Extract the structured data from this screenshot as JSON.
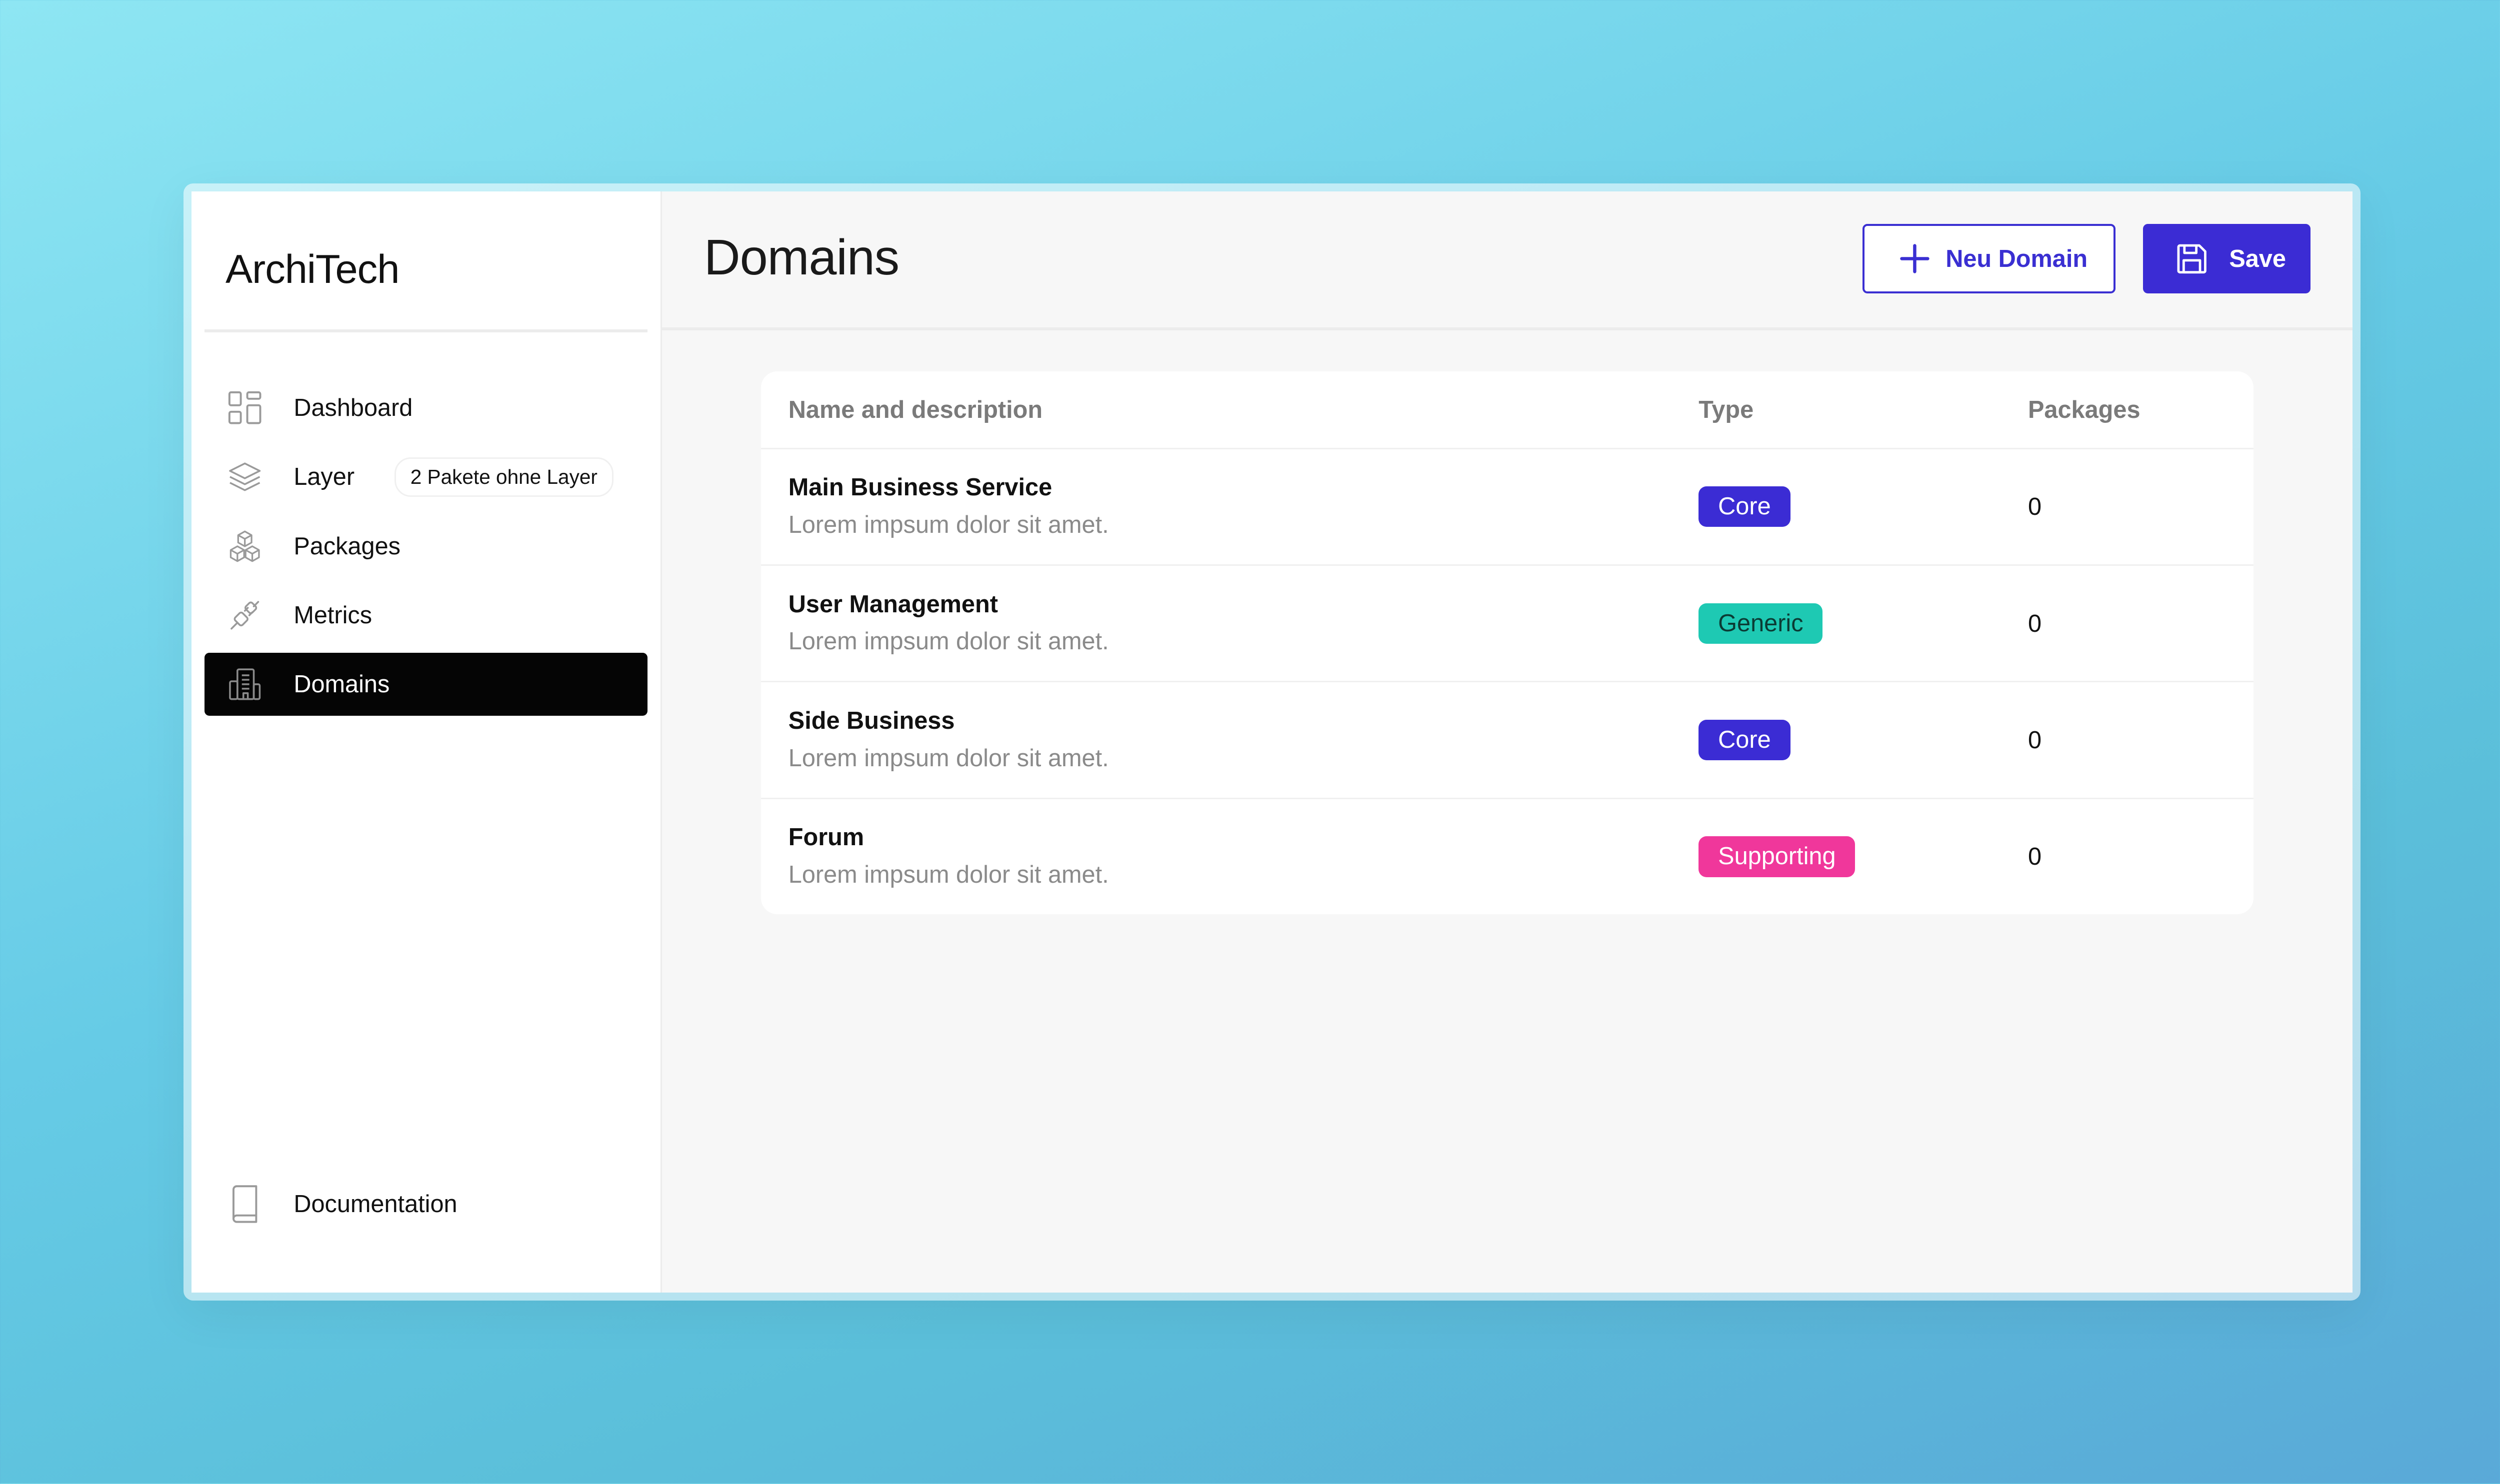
{
  "app": {
    "brand": "ArchiTech"
  },
  "sidebar": {
    "items": [
      {
        "label": "Dashboard",
        "icon": "dashboard-grid-icon"
      },
      {
        "label": "Layer",
        "icon": "layers-icon",
        "pill": "2 Pakete ohne Layer"
      },
      {
        "label": "Packages",
        "icon": "cubes-icon"
      },
      {
        "label": "Metrics",
        "icon": "plug-icon"
      },
      {
        "label": "Domains",
        "icon": "buildings-icon",
        "active": true
      }
    ],
    "footer": {
      "label": "Documentation",
      "icon": "book-icon"
    }
  },
  "header": {
    "title": "Domains",
    "new_button_label": "Neu Domain",
    "new_button_icon": "plus-icon",
    "save_button_label": "Save",
    "save_button_icon": "floppy-disk-icon"
  },
  "table": {
    "columns": [
      "Name and description",
      "Type",
      "Packages"
    ],
    "rows": [
      {
        "name": "Main Business Service",
        "description": "Lorem impsum dolor sit amet.",
        "type": "Core",
        "packages": "0"
      },
      {
        "name": "User Management",
        "description": "Lorem impsum dolor sit amet.",
        "type": "Generic",
        "packages": "0"
      },
      {
        "name": "Side Business",
        "description": "Lorem impsum dolor sit amet.",
        "type": "Core",
        "packages": "0"
      },
      {
        "name": "Forum",
        "description": "Lorem impsum dolor sit amet.",
        "type": "Supporting",
        "packages": "0"
      }
    ]
  },
  "colors": {
    "primary": "#3b2cd4",
    "core_badge": "#3b2cd4",
    "generic_badge": "#1ec9b3",
    "generic_badge_text": "#0b3b34",
    "supporting_badge": "#f0379b",
    "active_nav_bg": "#050505"
  }
}
